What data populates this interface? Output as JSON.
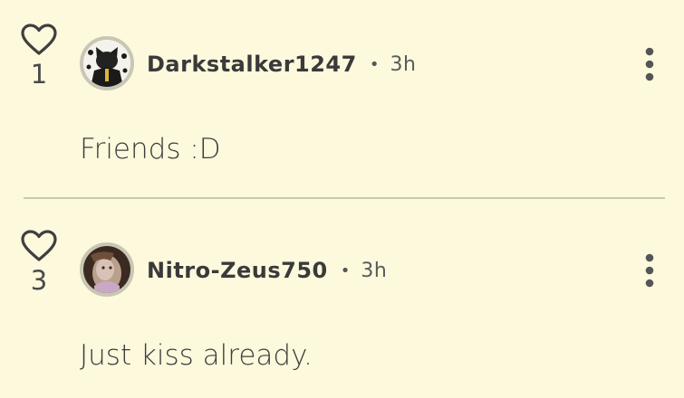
{
  "colors": {
    "background": "#fcf9dd",
    "divider": "#c8cbb0",
    "text": "#333333"
  },
  "comments": [
    {
      "likes": "1",
      "username": "Darkstalker1247",
      "separator": "•",
      "time": "3h",
      "text": "Friends :D",
      "like_icon": "heart-outline-icon",
      "menu_icon": "more-vertical-icon"
    },
    {
      "likes": "3",
      "username": "Nitro-Zeus750",
      "separator": "•",
      "time": "3h",
      "text": "Just kiss already.",
      "like_icon": "heart-outline-icon",
      "menu_icon": "more-vertical-icon"
    }
  ]
}
